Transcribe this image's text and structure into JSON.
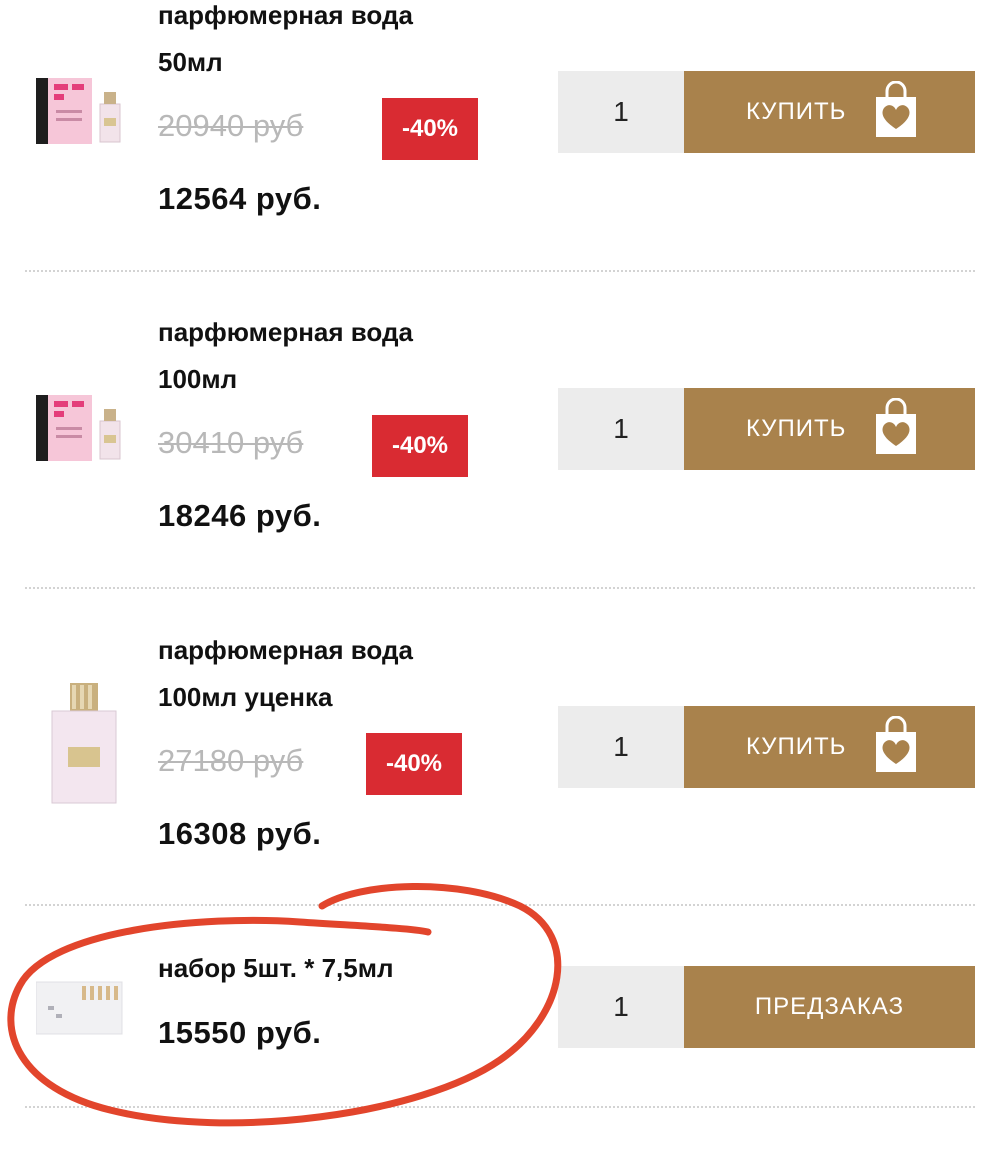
{
  "products": [
    {
      "title_lines": [
        "парфюмерная вода",
        "50мл"
      ],
      "old_price": "20940 руб",
      "discount": "-40%",
      "price": "12564 руб.",
      "qty": "1",
      "button": "КУПИТЬ",
      "icon": "shopping-bag-heart-icon"
    },
    {
      "title_lines": [
        "парфюмерная вода",
        "100мл"
      ],
      "old_price": "30410 руб",
      "discount": "-40%",
      "price": "18246 руб.",
      "qty": "1",
      "button": "КУПИТЬ",
      "icon": "shopping-bag-heart-icon"
    },
    {
      "title_lines": [
        "парфюмерная вода",
        "100мл уценка"
      ],
      "old_price": "27180 руб",
      "discount": "-40%",
      "price": "16308 руб.",
      "qty": "1",
      "button": "КУПИТЬ",
      "icon": "shopping-bag-heart-icon"
    },
    {
      "title_lines": [
        "набор 5шт. * 7,5мл"
      ],
      "price": "15550 руб.",
      "qty": "1",
      "button": "ПРЕДЗАКАЗ"
    }
  ],
  "colors": {
    "buy_button": "#a9824c",
    "discount_badge": "#d92b32",
    "qty_background": "#ececec",
    "annotation_circle": "#e2452c"
  }
}
